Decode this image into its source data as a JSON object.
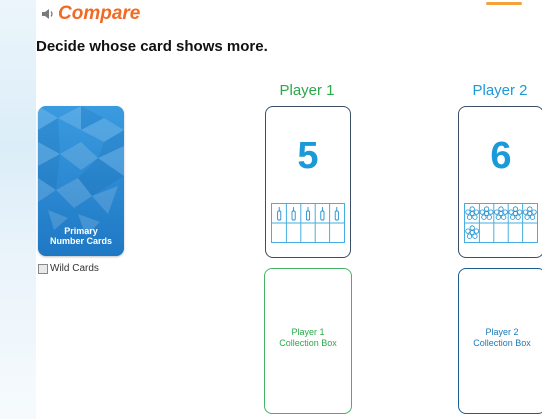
{
  "header": {
    "title": "Compare",
    "instruction": "Decide whose card shows more."
  },
  "deck": {
    "label_line1": "Primary",
    "label_line2": "Number Cards",
    "wild_cards_label": "Wild Cards",
    "wild_cards_checked": false
  },
  "players": [
    {
      "name": "Player 1",
      "card_value": "5",
      "tenframe_filled": 5,
      "tenframe_icon": "bottle-icon",
      "collection_line1": "Player 1",
      "collection_line2": "Collection Box"
    },
    {
      "name": "Player 2",
      "card_value": "6",
      "tenframe_filled": 6,
      "tenframe_icon": "flower-icon",
      "collection_line1": "Player 2",
      "collection_line2": "Collection Box"
    }
  ],
  "colors": {
    "title": "#f06b24",
    "player1": "#2aa84a",
    "player2": "#1b9ad7",
    "card_number": "#1a9ad8"
  }
}
